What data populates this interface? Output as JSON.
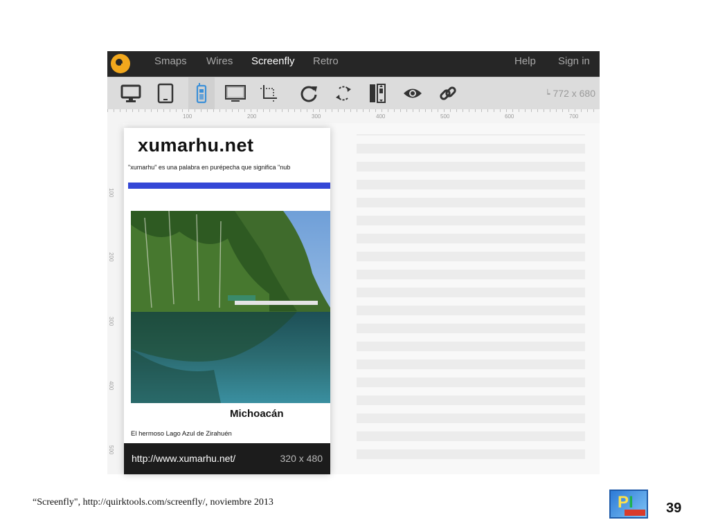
{
  "nav": {
    "items": [
      "Smaps",
      "Wires",
      "Screenfly",
      "Retro"
    ],
    "right_items": [
      "Help",
      "Sign in"
    ]
  },
  "toolbar": {
    "tools": [
      "desktop-icon",
      "tablet-icon",
      "mobile-icon",
      "tv-icon",
      "custom-size-icon",
      "refresh-icon",
      "rotate-icon",
      "scrollbars-icon",
      "preview-icon",
      "share-link-icon"
    ],
    "active_tool": "mobile-icon",
    "dimensions": "772 x 680"
  },
  "ruler": {
    "h_labels": [
      "100",
      "200",
      "300",
      "400",
      "500",
      "600",
      "700"
    ],
    "v_labels": [
      "100",
      "200",
      "300",
      "400",
      "500"
    ]
  },
  "preview": {
    "title": "xumarhu.net",
    "tagline": "\"xumarhu\" es una palabra en purépecha que significa \"nub",
    "caption": "Michoacán",
    "description": "El hermoso Lago Azul de Zirahuén",
    "url": "http://www.xumarhu.net/",
    "size": "320 x 480"
  },
  "slide": {
    "credit": "“Screenfly\", http://quirktools.com/screenfly/, noviembre 2013",
    "number": "39"
  },
  "colors": {
    "nav_bg": "#262626",
    "logo": "#f2a81d",
    "toolbar_bg": "#dcdcdc",
    "active_tool": "#3a8fd8",
    "site_bar": "#3447d6",
    "device_footer": "#1c1c1c"
  }
}
